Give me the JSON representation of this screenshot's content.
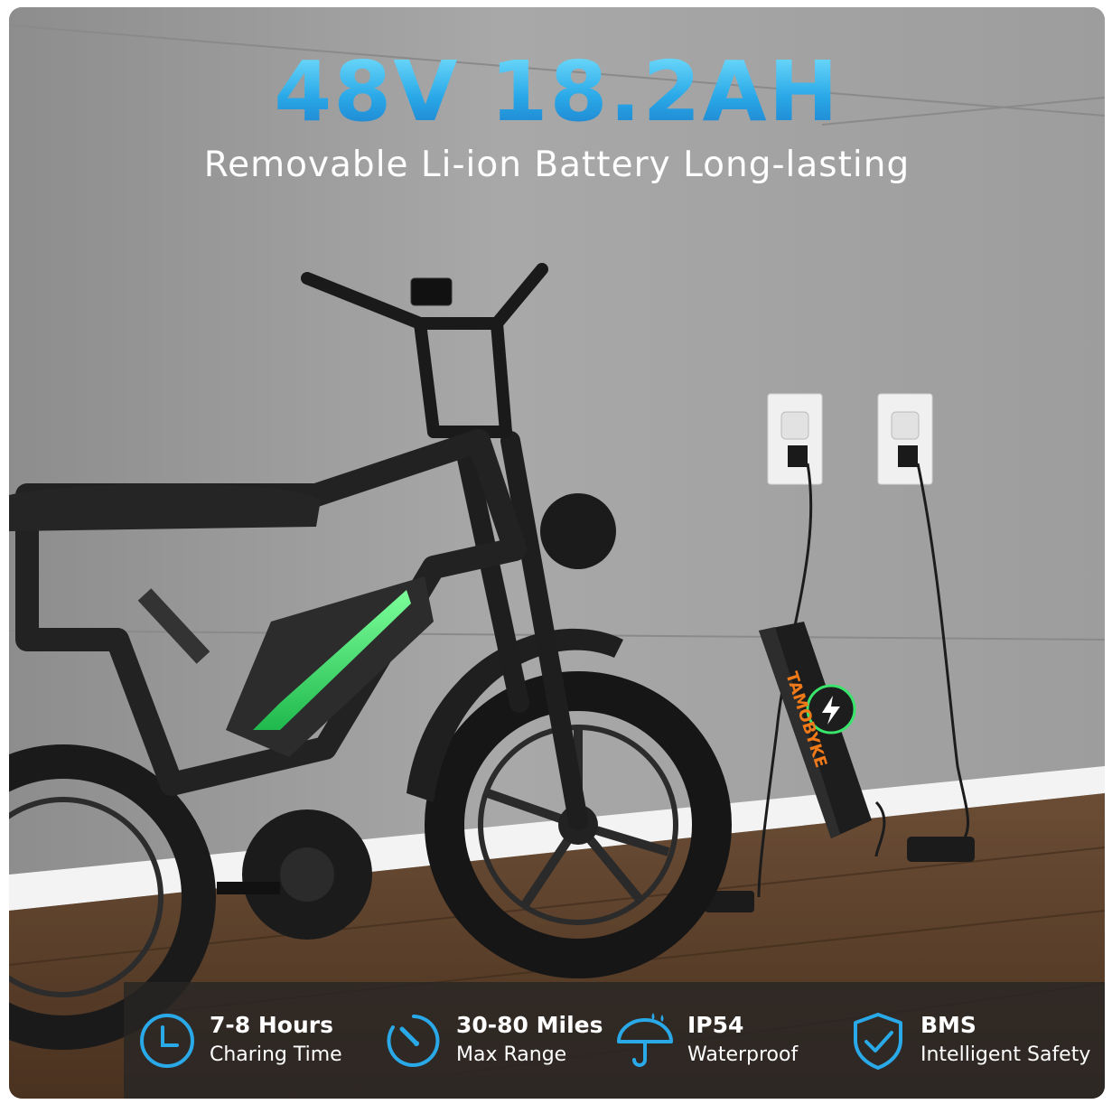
{
  "header": {
    "title": "48V 18.2AH",
    "subtitle": "Removable Li-ion Battery Long-lasting"
  },
  "battery": {
    "brand": "TAMOBYKE"
  },
  "features": [
    {
      "icon": "clock-icon",
      "title": "7-8 Hours",
      "subtitle": "Charing Time"
    },
    {
      "icon": "gauge-icon",
      "title": "30-80 Miles",
      "subtitle": "Max Range"
    },
    {
      "icon": "umbrella-icon",
      "title": "IP54",
      "subtitle": "Waterproof"
    },
    {
      "icon": "shield-check-icon",
      "title": "BMS",
      "subtitle": "Intelligent Safety"
    }
  ],
  "colors": {
    "accent": "#2aa9e8",
    "battery_glow": "#39e56b",
    "brand_orange": "#f07a1a"
  }
}
